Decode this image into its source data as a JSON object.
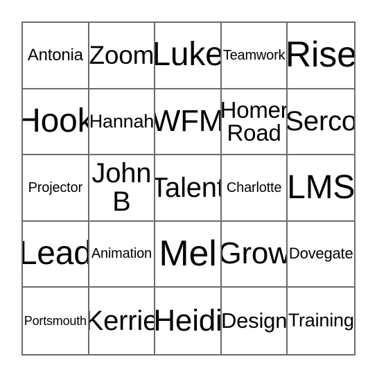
{
  "card": {
    "type": "bingo-card",
    "grid": {
      "rows": 5,
      "columns": 5
    },
    "colors": {
      "background": "#ffffff",
      "border": "#6b6b6b",
      "text": "#000000"
    },
    "cells": [
      {
        "text": "Antonia",
        "size": "fs-m",
        "lines": 1
      },
      {
        "text": "Zoom",
        "size": "fs-xl",
        "lines": 1
      },
      {
        "text": "Luke",
        "size": "fs-hx",
        "lines": 1
      },
      {
        "text": "Teamwork",
        "size": "fs-s",
        "lines": 1
      },
      {
        "text": "Rise",
        "size": "fs-max",
        "lines": 1
      },
      {
        "text": "Hook",
        "size": "fs-hx",
        "lines": 1
      },
      {
        "text": "Hannah",
        "size": "fs-ml",
        "lines": 1
      },
      {
        "text": "WFM",
        "size": "fs-h",
        "lines": 1
      },
      {
        "text": "Homer\nRoad",
        "size": "fs-lr",
        "lines": 2
      },
      {
        "text": "Serco",
        "size": "fs-xxl",
        "lines": 1
      },
      {
        "text": "Projector",
        "size": "fs-s",
        "lines": 1
      },
      {
        "text": "John\nB",
        "size": "fs-xxl",
        "lines": 2
      },
      {
        "text": "Talent",
        "size": "fs-xxl",
        "lines": 1
      },
      {
        "text": "Charlotte",
        "size": "fs-s",
        "lines": 1
      },
      {
        "text": "LMS",
        "size": "fs-hx",
        "lines": 1
      },
      {
        "text": "Lead",
        "size": "fs-hx",
        "lines": 1
      },
      {
        "text": "Animation",
        "size": "fs-s",
        "lines": 1
      },
      {
        "text": "Mel",
        "size": "fs-max",
        "lines": 1
      },
      {
        "text": "Grow",
        "size": "fs-h",
        "lines": 1
      },
      {
        "text": "Dovegate",
        "size": "fs-sm",
        "lines": 1
      },
      {
        "text": "Portsmouth",
        "size": "fs-xs",
        "lines": 1
      },
      {
        "text": "Kerrie",
        "size": "fs-xxl",
        "lines": 1
      },
      {
        "text": "Heidi",
        "size": "fs-h",
        "lines": 1
      },
      {
        "text": "Design",
        "size": "fs-l",
        "lines": 1
      },
      {
        "text": "Training",
        "size": "fs-ml",
        "lines": 1
      }
    ]
  }
}
